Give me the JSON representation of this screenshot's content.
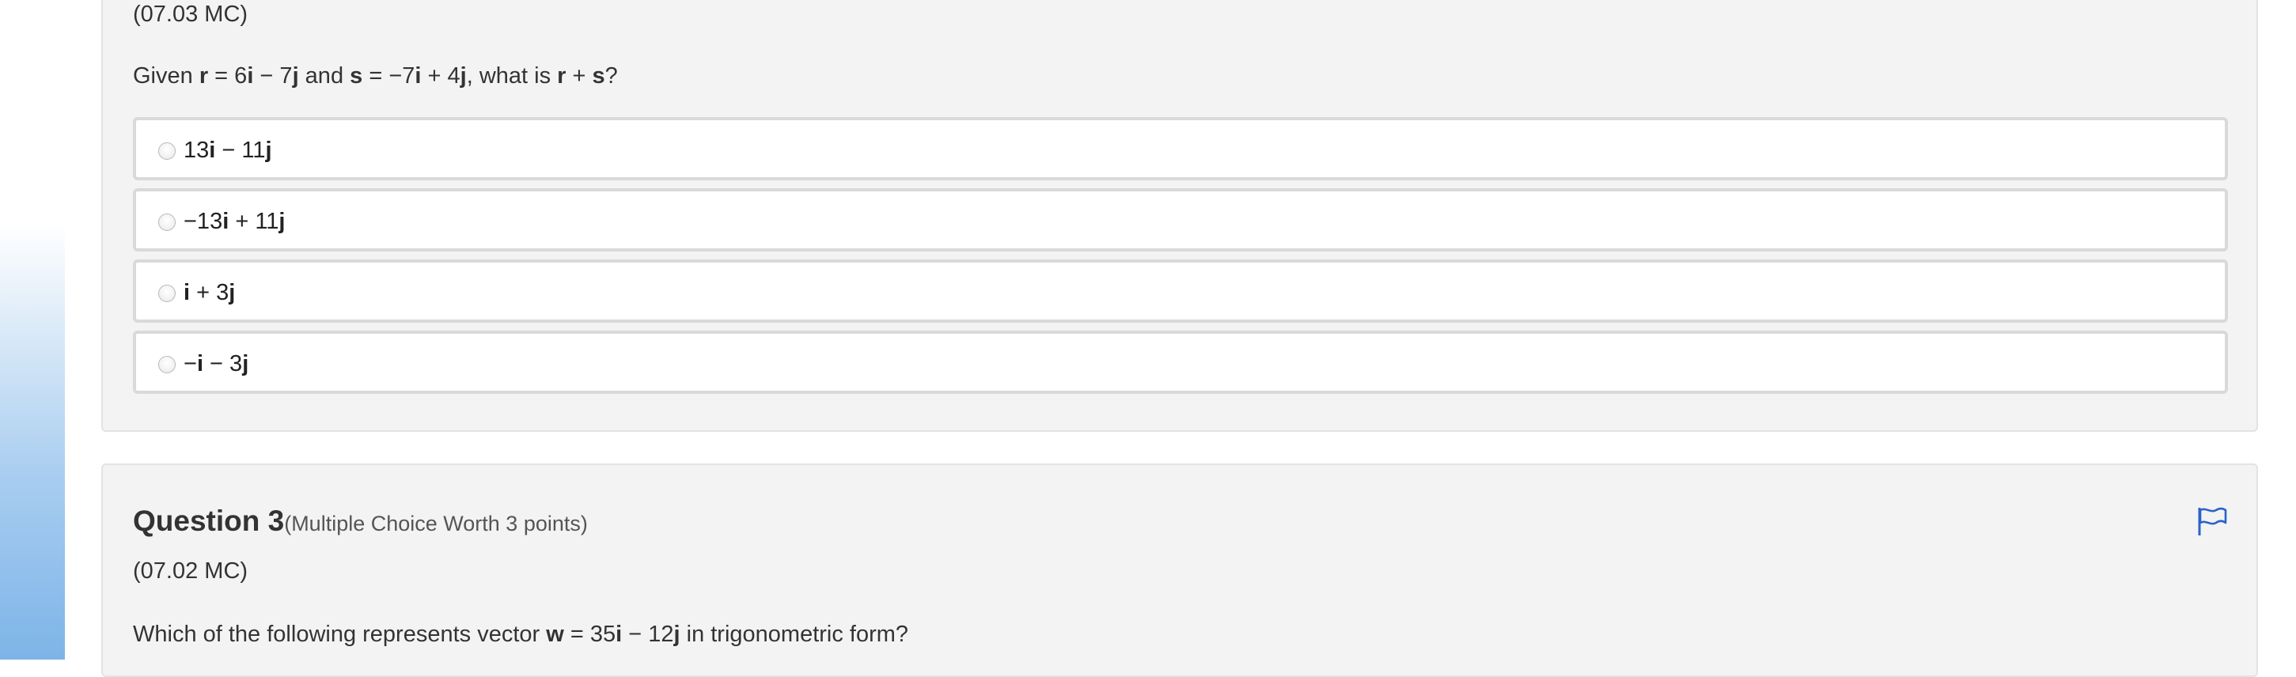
{
  "question2": {
    "code": "(07.03 MC)",
    "prompt": {
      "parts": [
        {
          "text": "Given ",
          "bold": false
        },
        {
          "text": "r",
          "bold": true
        },
        {
          "text": " = 6",
          "bold": false
        },
        {
          "text": "i",
          "bold": true
        },
        {
          "text": " − 7",
          "bold": false
        },
        {
          "text": "j",
          "bold": true
        },
        {
          "text": " and ",
          "bold": false
        },
        {
          "text": "s",
          "bold": true
        },
        {
          "text": " = −7",
          "bold": false
        },
        {
          "text": "i",
          "bold": true
        },
        {
          "text": " + 4",
          "bold": false
        },
        {
          "text": "j",
          "bold": true
        },
        {
          "text": ", what is ",
          "bold": false
        },
        {
          "text": "r",
          "bold": true
        },
        {
          "text": " + ",
          "bold": false
        },
        {
          "text": "s",
          "bold": true
        },
        {
          "text": "?",
          "bold": false
        }
      ]
    },
    "options": [
      {
        "parts": [
          {
            "text": "13",
            "bold": false
          },
          {
            "text": "i",
            "bold": true
          },
          {
            "text": " − 11",
            "bold": false
          },
          {
            "text": "j",
            "bold": true
          }
        ],
        "selected": false
      },
      {
        "parts": [
          {
            "text": "−13",
            "bold": false
          },
          {
            "text": "i",
            "bold": true
          },
          {
            "text": " + 11",
            "bold": false
          },
          {
            "text": "j",
            "bold": true
          }
        ],
        "selected": false
      },
      {
        "parts": [
          {
            "text": "i",
            "bold": true
          },
          {
            "text": " + 3",
            "bold": false
          },
          {
            "text": "j",
            "bold": true
          }
        ],
        "selected": false
      },
      {
        "parts": [
          {
            "text": "−",
            "bold": false
          },
          {
            "text": "i",
            "bold": true
          },
          {
            "text": " − 3",
            "bold": false
          },
          {
            "text": "j",
            "bold": true
          }
        ],
        "selected": false
      }
    ]
  },
  "question3": {
    "title": "Question 3",
    "worth": "(Multiple Choice Worth 3 points)",
    "code": "(07.02 MC)",
    "prompt": {
      "parts": [
        {
          "text": "Which of the following represents vector ",
          "bold": false
        },
        {
          "text": "w",
          "bold": true
        },
        {
          "text": " = 35",
          "bold": false
        },
        {
          "text": "i",
          "bold": true
        },
        {
          "text": " − 12",
          "bold": false
        },
        {
          "text": "j",
          "bold": true
        },
        {
          "text": " in trigonometric form?",
          "bold": false
        }
      ]
    },
    "flag_icon": "flag-icon"
  },
  "colors": {
    "panel_bg": "#f3f3f3",
    "option_border": "#d9d9d9",
    "flag": "#2a62c9",
    "gutter_gradient_end": "#7db4e8"
  }
}
